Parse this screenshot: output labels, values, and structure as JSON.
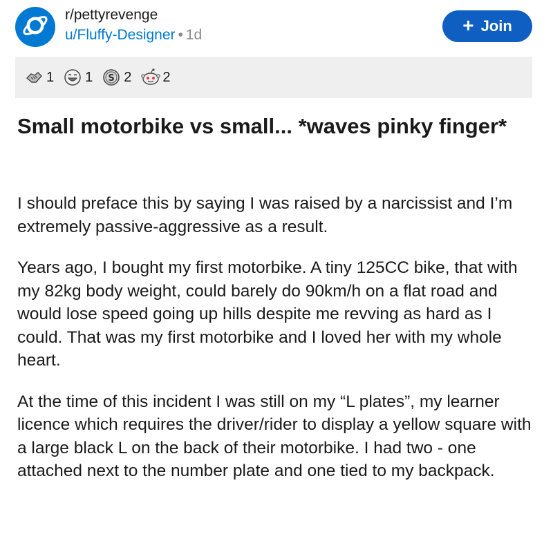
{
  "header": {
    "subreddit": "r/pettyrevenge",
    "author": "u/Fluffy-Designer",
    "separator": "•",
    "time": "1d",
    "join_label": "Join",
    "join_icon": "plus-icon",
    "avatar_icon": "planet-icon"
  },
  "awards": [
    {
      "icon": "handshake-award-icon",
      "count": "1"
    },
    {
      "icon": "laughing-face-award-icon",
      "count": "1"
    },
    {
      "icon": "silver-coin-award-icon",
      "count": "2"
    },
    {
      "icon": "snoo-award-icon",
      "count": "2"
    }
  ],
  "post": {
    "title": "Small motorbike vs small... *waves pinky finger*",
    "paragraphs": [
      "I should preface this by saying I was raised by a narcissist and I’m extremely passive-aggressive as a result.",
      "Years ago, I bought my first motorbike. A tiny 125CC bike, that with my 82kg body weight, could barely do 90km/h on a flat road and would lose speed going up hills despite me revving as hard as I could. That was my first motorbike and I loved her with my whole heart.",
      "At the time of this incident I was still on my “L plates”, my learner licence which requires the driver/rider to display a yellow square with a large black L on the back of their motorbike. I had two - one attached next to the number plate and one tied to my backpack."
    ]
  },
  "colors": {
    "brand_blue": "#0079d3",
    "join_button": "#0f5fc2",
    "award_bar": "#efefef"
  }
}
